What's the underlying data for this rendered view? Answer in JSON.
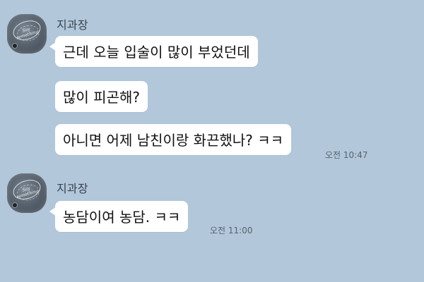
{
  "messages": [
    {
      "sender": "지과장",
      "avatar_text": "Say something",
      "bubbles": [
        "근데 오늘 입술이 많이 부었던데",
        "많이 피곤해?",
        "아니면 어제 남친이랑 화끈했나? ㅋㅋ"
      ],
      "time": "오전 10:47"
    },
    {
      "sender": "지과장",
      "avatar_text": "Say something",
      "bubbles": [
        "농담이여 농담. ㅋㅋ"
      ],
      "time": "오전 11:00"
    }
  ],
  "colors": {
    "background": "#b2c7d9",
    "bubble": "#ffffff",
    "sender_text": "#384452",
    "time_text": "#58636f"
  }
}
